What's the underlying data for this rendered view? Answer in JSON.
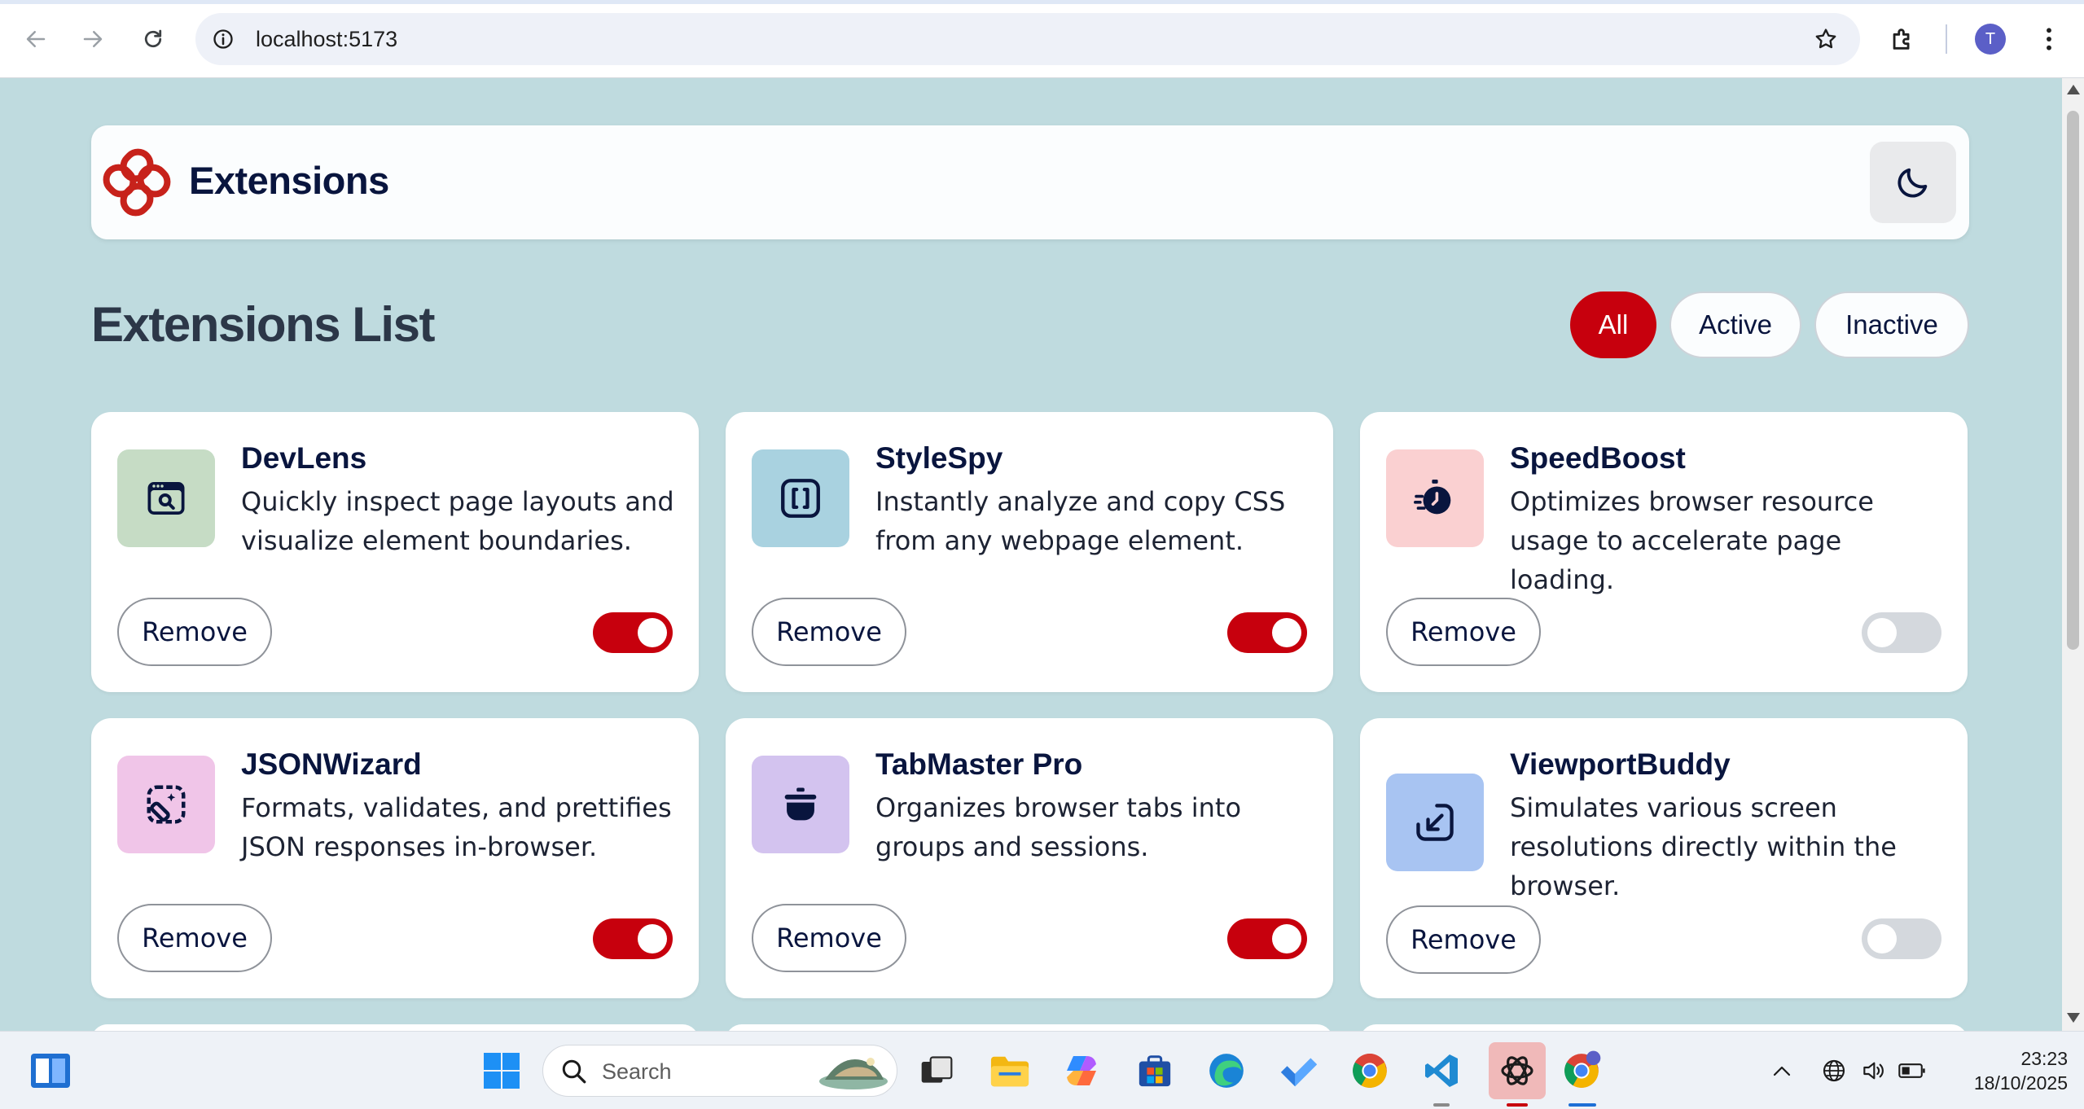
{
  "browser": {
    "url": "localhost:5173",
    "profile_initial": "T"
  },
  "header": {
    "brand": "Extensions"
  },
  "list": {
    "title": "Extensions List",
    "filters": [
      "All",
      "Active",
      "Inactive"
    ],
    "active_filter": "All"
  },
  "colors": {
    "accent": "#c7000d",
    "background": "#bfdbdf",
    "navy": "#09153e"
  },
  "extensions": [
    {
      "name": "DevLens",
      "description": "Quickly inspect page layouts and visualize element boundaries.",
      "remove_label": "Remove",
      "active": true,
      "icon": "devlens-search-window-icon",
      "icon_bg": "#c6dcc5"
    },
    {
      "name": "StyleSpy",
      "description": "Instantly analyze and copy CSS from any webpage element.",
      "remove_label": "Remove",
      "active": true,
      "icon": "stylespy-brackets-icon",
      "icon_bg": "#a9d2e0"
    },
    {
      "name": "SpeedBoost",
      "description": "Optimizes browser resource usage to accelerate page loading.",
      "remove_label": "Remove",
      "active": false,
      "icon": "speedboost-stopwatch-icon",
      "icon_bg": "#fad0d1"
    },
    {
      "name": "JSONWizard",
      "description": "Formats, validates, and prettifies JSON responses in-browser.",
      "remove_label": "Remove",
      "active": true,
      "icon": "jsonwizard-wand-icon",
      "icon_bg": "#f0c5e8"
    },
    {
      "name": "TabMaster Pro",
      "description": "Organizes browser tabs into groups and sessions.",
      "remove_label": "Remove",
      "active": true,
      "icon": "tabmaster-pot-icon",
      "icon_bg": "#d3c3ef"
    },
    {
      "name": "ViewportBuddy",
      "description": "Simulates various screen resolutions directly within the browser.",
      "remove_label": "Remove",
      "active": false,
      "icon": "viewportbuddy-resize-icon",
      "icon_bg": "#a8c4f2"
    }
  ],
  "taskbar": {
    "search_placeholder": "Search",
    "time": "23:23",
    "date": "18/10/2025"
  }
}
